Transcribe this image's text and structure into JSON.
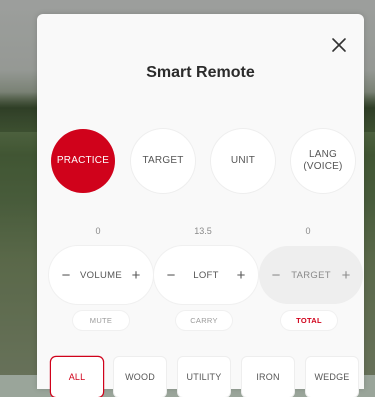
{
  "header": {
    "title": "Smart Remote"
  },
  "modes": [
    {
      "label": "PRACTICE",
      "active": true
    },
    {
      "label": "TARGET",
      "active": false
    },
    {
      "label": "UNIT",
      "active": false
    },
    {
      "label": "LANG\n(VOICE)",
      "active": false
    }
  ],
  "controls": [
    {
      "value": "0",
      "name": "VOLUME",
      "minus": "−",
      "plus": "+",
      "sub": "MUTE"
    },
    {
      "value": "13.5",
      "name": "LOFT",
      "minus": "−",
      "plus": "+",
      "sub": "CARRY"
    },
    {
      "value": "0",
      "name": "TARGET",
      "minus": "−",
      "plus": "+",
      "sub": "TOTAL"
    }
  ],
  "clubs": [
    {
      "label": "ALL",
      "active": true
    },
    {
      "label": "WOOD",
      "active": false
    },
    {
      "label": "UTILITY",
      "active": false
    },
    {
      "label": "IRON",
      "active": false
    },
    {
      "label": "WEDGE",
      "active": false
    }
  ],
  "colors": {
    "accent": "#d0021b",
    "sheet": "#f9f9f9"
  },
  "icons": {
    "close": "close-icon"
  }
}
